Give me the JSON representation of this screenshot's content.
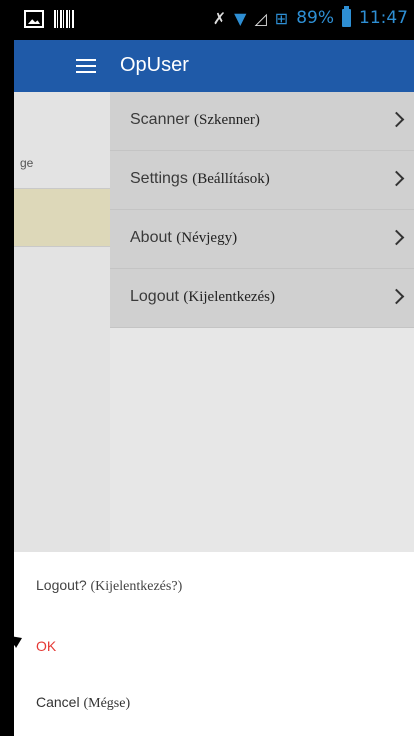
{
  "status_bar": {
    "battery_percent": "89%",
    "time": "11:47",
    "left_icons": [
      "image-icon",
      "barcode-icon"
    ],
    "right_icons": [
      "mute-icon",
      "wifi-icon",
      "signal-icon",
      "network-icon",
      "battery-icon"
    ]
  },
  "app_bar": {
    "title": "OpUser",
    "menu_icon": "hamburger-menu-icon",
    "background": "#1f5aa8"
  },
  "left_pane": {
    "fragment_text": "ge"
  },
  "drawer": {
    "items": [
      {
        "label": "Scanner",
        "label_hu": "(Szkenner)",
        "icon": "chevron-right-icon"
      },
      {
        "label": "Settings",
        "label_hu": "(Beállítások)",
        "icon": "chevron-right-icon"
      },
      {
        "label": "About",
        "label_hu": "(Névjegy)",
        "icon": "chevron-right-icon"
      },
      {
        "label": "Logout",
        "label_hu": "(Kijelentkezés)",
        "icon": "chevron-right-icon"
      }
    ]
  },
  "dialog": {
    "title": "Logout?",
    "title_hu": "(Kijelentkezés?)",
    "ok_label": "OK",
    "ok_color": "#e53935",
    "cancel_label": "Cancel",
    "cancel_hu": "(Mégse)"
  }
}
